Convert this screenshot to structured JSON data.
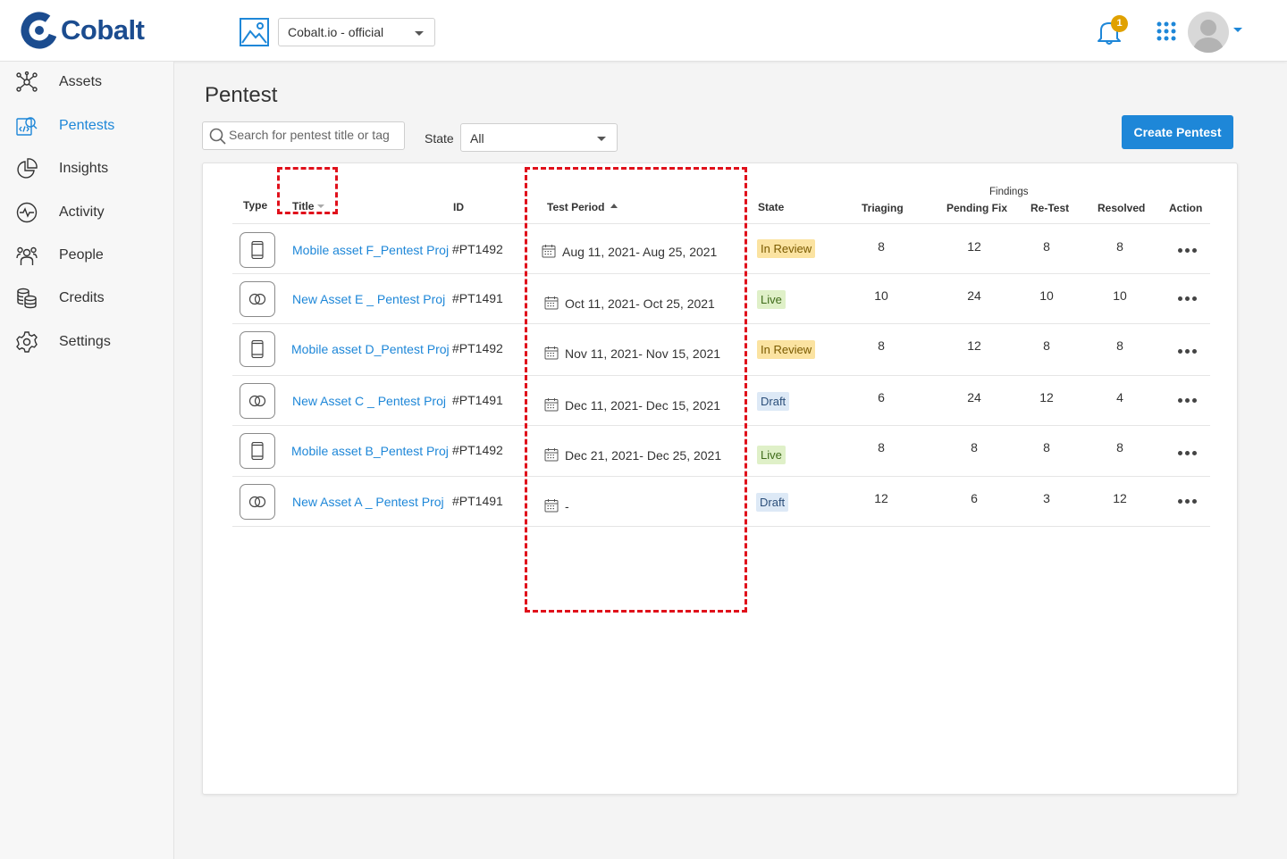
{
  "app": {
    "name": "Cobalt"
  },
  "org_selector": {
    "value": "Cobalt.io - official"
  },
  "notifications": {
    "count": "1"
  },
  "sidebar": {
    "items": [
      {
        "label": "Assets",
        "icon": "assets-icon"
      },
      {
        "label": "Pentests",
        "icon": "pentests-icon",
        "active": true
      },
      {
        "label": "Insights",
        "icon": "insights-icon"
      },
      {
        "label": "Activity",
        "icon": "activity-icon"
      },
      {
        "label": "People",
        "icon": "people-icon"
      },
      {
        "label": "Credits",
        "icon": "credits-icon"
      },
      {
        "label": "Settings",
        "icon": "settings-icon"
      }
    ]
  },
  "page": {
    "title": "Pentest",
    "search_placeholder": "Search for pentest title or tag",
    "state_label": "State",
    "state_value": "All",
    "create_button": "Create Pentest"
  },
  "table": {
    "findings_group": "Findings",
    "headers": {
      "type": "Type",
      "title": "Title",
      "id": "ID",
      "test_period": "Test Period",
      "state": "State",
      "triaging": "Triaging",
      "pending_fix": "Pending Fix",
      "retest": "Re-Test",
      "resolved": "Resolved",
      "action": "Action"
    },
    "rows": [
      {
        "type": "mobile",
        "title": "Mobile asset F_Pentest Proj",
        "id": "#PT1492",
        "period": "Aug 11, 2021- Aug 25, 2021",
        "state": "In Review",
        "triaging": "8",
        "pending_fix": "12",
        "retest": "8",
        "resolved": "8"
      },
      {
        "type": "web",
        "title": "New Asset E _ Pentest Proj",
        "id": "#PT1491",
        "period": "Oct 11, 2021- Oct 25, 2021",
        "state": "Live",
        "triaging": "10",
        "pending_fix": "24",
        "retest": "10",
        "resolved": "10"
      },
      {
        "type": "mobile",
        "title": "Mobile asset D_Pentest Proj",
        "id": "#PT1492",
        "period": "Nov 11, 2021- Nov 15, 2021",
        "state": "In Review",
        "triaging": "8",
        "pending_fix": "12",
        "retest": "8",
        "resolved": "8"
      },
      {
        "type": "web",
        "title": "New Asset C _ Pentest Proj",
        "id": "#PT1491",
        "period": "Dec 11, 2021- Dec 15, 2021",
        "state": "Draft",
        "triaging": "6",
        "pending_fix": "24",
        "retest": "12",
        "resolved": "4"
      },
      {
        "type": "mobile",
        "title": "Mobile asset B_Pentest Proj",
        "id": "#PT1492",
        "period": "Dec 21, 2021- Dec 25, 2021",
        "state": "Live",
        "triaging": "8",
        "pending_fix": "8",
        "retest": "8",
        "resolved": "8"
      },
      {
        "type": "web",
        "title": "New Asset A _ Pentest Proj",
        "id": "#PT1491",
        "period": "-",
        "state": "Draft",
        "triaging": "12",
        "pending_fix": "6",
        "retest": "3",
        "resolved": "12"
      }
    ]
  },
  "colors": {
    "accent": "#1e87d8",
    "brand": "#1b4c8f",
    "in_review_bg": "#fbe3a1",
    "live_bg": "#dff0c8",
    "draft_bg": "#dde9f6",
    "annotation": "#e0101b"
  }
}
